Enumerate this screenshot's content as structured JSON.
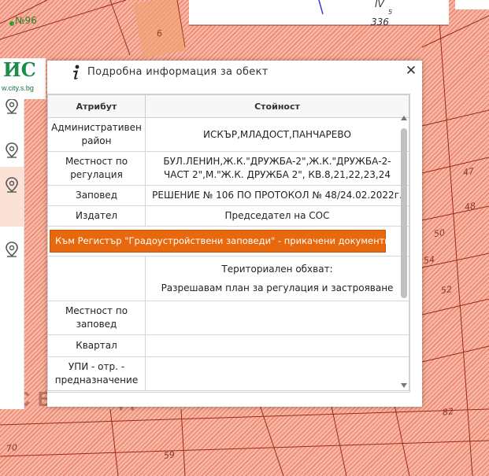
{
  "map": {
    "poi_label": "№96",
    "top_right": {
      "numeral": "IV",
      "sup": "5",
      "number": "336"
    },
    "parcel_labels": [
      "6",
      "47",
      "48",
      "50",
      "54",
      "52",
      "59",
      "70",
      "82"
    ],
    "watermark": "ИС БГ ЕООД",
    "hatch_color": "#ef7f66"
  },
  "logo": {
    "text": "ИС",
    "subtext": "w.city.s.bg"
  },
  "dialog": {
    "title": "Подробна информация за обект",
    "close_symbol": "✕",
    "columns": {
      "attribute": "Атрибут",
      "value": "Стойност"
    },
    "rows": [
      {
        "attribute": "Административен район",
        "value": "ИСКЪР,МЛАДОСТ,ПАНЧАРЕВО"
      },
      {
        "attribute": "Местност по регулация",
        "value": "БУЛ.ЛЕНИН,Ж.К.\"ДРУЖБА-2\",Ж.К.\"ДРУЖБА-2-ЧАСТ 2\",М.\"Ж.К. ДРУЖБА 2\", КВ.8,21,22,23,24"
      },
      {
        "attribute": "Заповед",
        "value": "РЕШЕНИЕ № 106 ПО ПРОТОКОЛ № 48/24.02.2022г."
      },
      {
        "attribute": "Издател",
        "value": "Председател на СОС"
      }
    ],
    "link_button": "Към Регистър \"Градоустройствени заповеди\" - прикачени документи",
    "extra_lines": [
      "Териториален обхват:",
      "Разрешавам план за регулация и застрояване"
    ],
    "empty_rows": [
      {
        "attribute": "Местност по заповед",
        "value": ""
      },
      {
        "attribute": "Квартал",
        "value": ""
      },
      {
        "attribute": "УПИ - отр. - предназначение",
        "value": ""
      }
    ],
    "accent_color": "#e8680e"
  }
}
